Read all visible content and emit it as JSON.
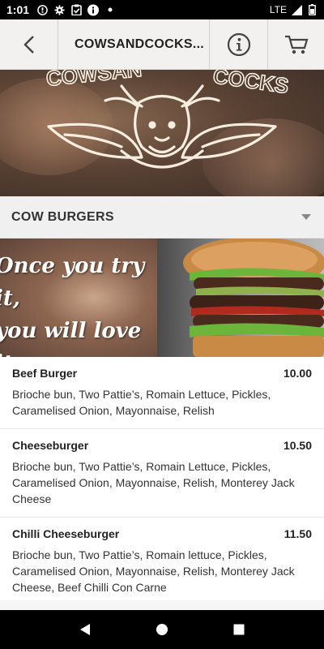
{
  "status_bar": {
    "time": "1:01",
    "network": "LTE"
  },
  "header": {
    "title": "COWSANDCOCKS..."
  },
  "banner": {
    "logo_text": "COWSANDCOCKS"
  },
  "category": {
    "label": "COW BURGERS"
  },
  "promo": {
    "line1": "Once you try it,",
    "line2": "you will love it."
  },
  "menu_items": [
    {
      "name": "Beef Burger",
      "price": "10.00",
      "description": "Brioche bun, Two Pattie’s, Romain Lettuce, Pickles, Caramelised Onion, Mayonnaise, Relish"
    },
    {
      "name": "Cheeseburger",
      "price": "10.50",
      "description": "Brioche bun, Two Pattie’s, Romain Lettuce, Pickles, Caramelised Onion, Mayonnaise, Relish, Monterey Jack Cheese"
    },
    {
      "name": "Chilli Cheeseburger",
      "price": "11.50",
      "description": "Brioche bun, Two Pattie’s, Romain lettuce, Pickles, Caramelised Onion, Mayonnaise, Relish, Monterey Jack Cheese, Beef Chilli Con Carne"
    }
  ],
  "colors": {
    "header_bg": "#f3f1f0",
    "category_bg": "#f0f0f0",
    "status_bar_bg": "#000000",
    "nav_bar_bg": "#000000",
    "text": "#222222"
  }
}
